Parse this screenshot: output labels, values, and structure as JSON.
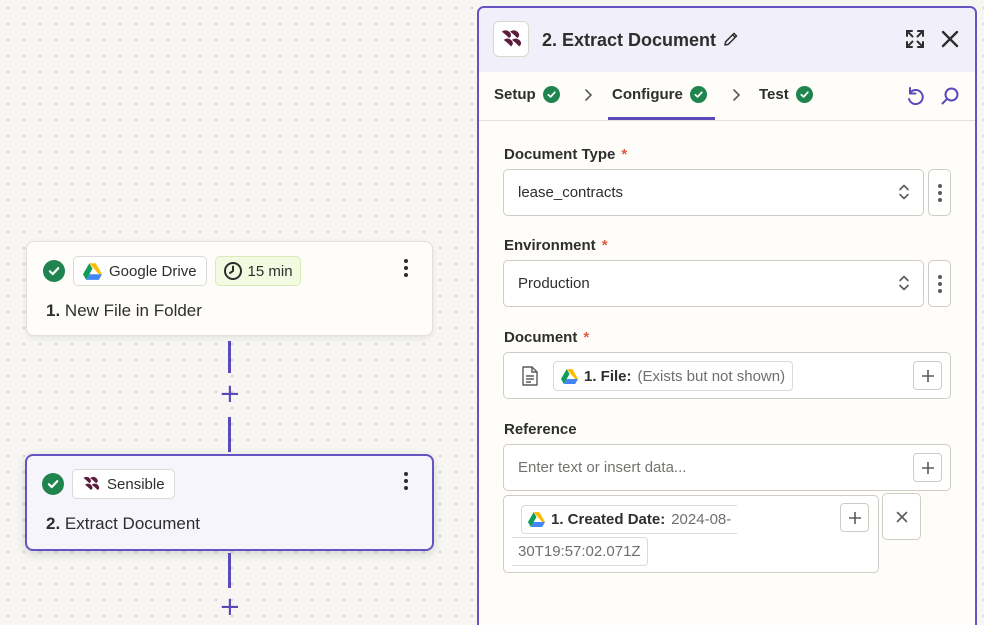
{
  "canvas": {
    "step1": {
      "app_name": "Google Drive",
      "poll_interval": "15 min",
      "number": "1.",
      "title": "New File in Folder"
    },
    "step2": {
      "app_name": "Sensible",
      "number": "2.",
      "title": "Extract Document"
    }
  },
  "panel": {
    "title": "2. Extract Document",
    "tabs": [
      {
        "label": "Setup",
        "status": "complete"
      },
      {
        "label": "Configure",
        "status": "complete",
        "active": true
      },
      {
        "label": "Test",
        "status": "complete"
      }
    ],
    "fields": {
      "document_type": {
        "label": "Document Type",
        "required": "*",
        "value": "lease_contracts"
      },
      "environment": {
        "label": "Environment",
        "required": "*",
        "value": "Production"
      },
      "document": {
        "label": "Document",
        "required": "*",
        "pill_label": "1. File:",
        "pill_value": "(Exists but not shown)"
      },
      "reference": {
        "label": "Reference",
        "placeholder": "Enter text or insert data...",
        "pill_label": "1. Created Date:",
        "pill_value_part1": "2024-08-",
        "pill_value_part2": "30T19:57:02.071Z"
      }
    }
  },
  "colors": {
    "accent": "#5b48b9",
    "success": "#20844f",
    "required": "#e05a47",
    "sensible_brand": "#5a1e3c"
  },
  "icons": [
    "check-icon",
    "google-drive-icon",
    "clock-icon",
    "sensible-icon",
    "more-vertical-icon",
    "plus-icon",
    "pencil-icon",
    "expand-icon",
    "close-icon",
    "chevron-right-icon",
    "undo-icon",
    "search-icon",
    "updown-chevron-icon",
    "file-icon"
  ]
}
